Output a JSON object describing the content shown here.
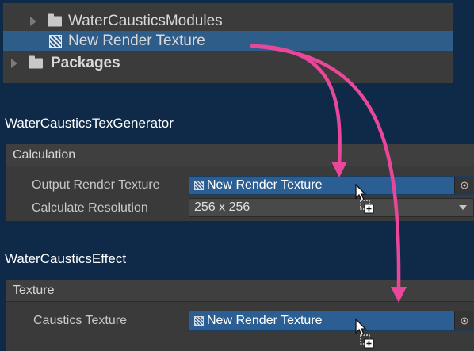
{
  "project_tree": {
    "items": [
      {
        "label": "WaterCausticsModules",
        "icon": "folder-icon",
        "expand": "collapsed"
      },
      {
        "label": "New Render Texture",
        "icon": "render-texture-icon",
        "selected": true
      },
      {
        "label": "Packages",
        "icon": "folder-icon",
        "expand": "collapsed"
      }
    ]
  },
  "tex_generator": {
    "title": "WaterCausticsTexGenerator",
    "section": "Calculation",
    "output_label": "Output Render Texture",
    "output_value": "New Render Texture",
    "resolution_label": "Calculate Resolution",
    "resolution_value": "256 x 256"
  },
  "effect": {
    "title": "WaterCausticsEffect",
    "section": "Texture",
    "texture_label": "Caustics Texture",
    "texture_value": "New Render Texture"
  },
  "colors": {
    "background": "#0e2a48",
    "selection": "#2f5d8a",
    "object_field": "#2b5f93",
    "arrow": "#e8479a"
  }
}
